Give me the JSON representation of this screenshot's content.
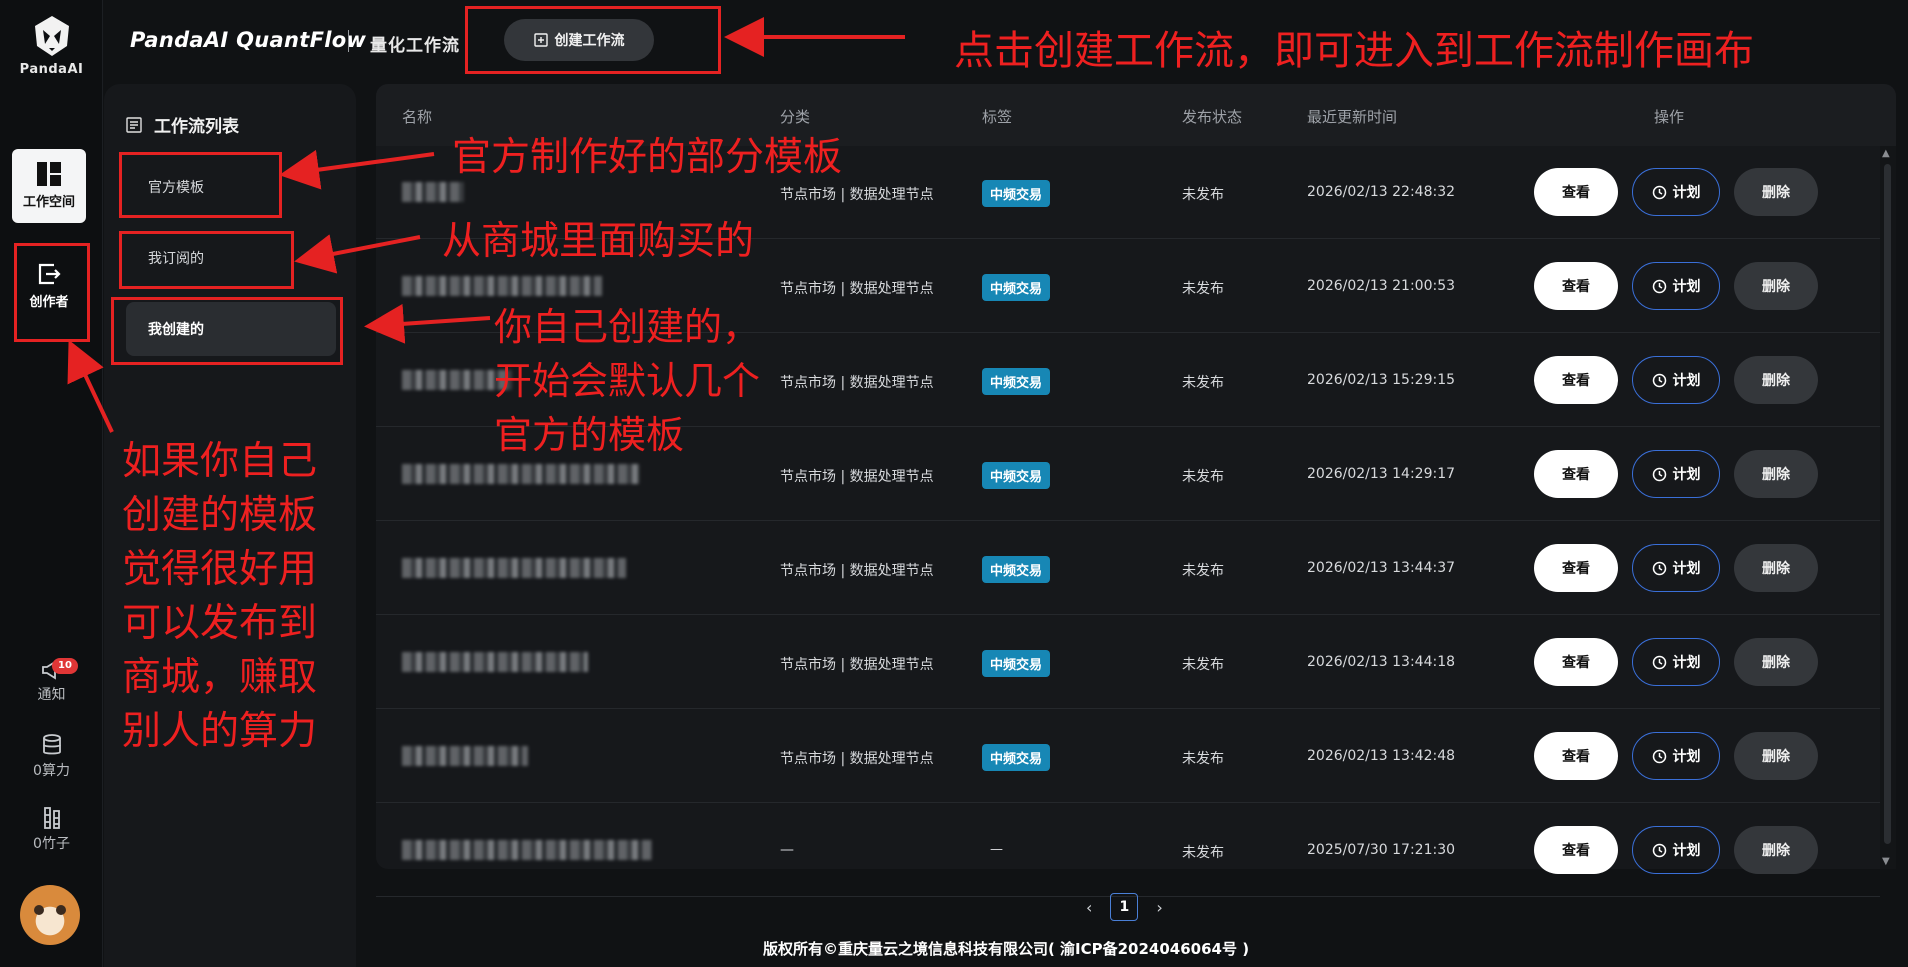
{
  "app": {
    "logo_text": "PandaAI",
    "brand": "PandaAI QuantFlow",
    "brand_sub": "量化工作流",
    "create_button": "创建工作流"
  },
  "rail": {
    "workspace_label": "工作空间",
    "creator_label": "创作者",
    "notify_label": "通知",
    "notify_badge": "10",
    "compute_label": "0算力",
    "bamboo_label": "0竹子"
  },
  "panel": {
    "title": "工作流列表",
    "items": [
      {
        "label": "官方模板"
      },
      {
        "label": "我订阅的"
      },
      {
        "label": "我创建的"
      }
    ]
  },
  "table": {
    "headers": [
      "名称",
      "分类",
      "标签",
      "发布状态",
      "最近更新时间",
      "操作"
    ],
    "rows": [
      {
        "category": "节点市场 | 数据处理节点",
        "tag": "中频交易",
        "status": "未发布",
        "updated": "2026/02/13 22:48:32"
      },
      {
        "category": "节点市场 | 数据处理节点",
        "tag": "中频交易",
        "status": "未发布",
        "updated": "2026/02/13 21:00:53"
      },
      {
        "category": "节点市场 | 数据处理节点",
        "tag": "中频交易",
        "status": "未发布",
        "updated": "2026/02/13 15:29:15"
      },
      {
        "category": "节点市场 | 数据处理节点",
        "tag": "中频交易",
        "status": "未发布",
        "updated": "2026/02/13 14:29:17"
      },
      {
        "category": "节点市场 | 数据处理节点",
        "tag": "中频交易",
        "status": "未发布",
        "updated": "2026/02/13 13:44:37"
      },
      {
        "category": "节点市场 | 数据处理节点",
        "tag": "中频交易",
        "status": "未发布",
        "updated": "2026/02/13 13:44:18"
      },
      {
        "category": "节点市场 | 数据处理节点",
        "tag": "中频交易",
        "status": "未发布",
        "updated": "2026/02/13 13:42:48"
      },
      {
        "category": "—",
        "tag": "—",
        "status": "未发布",
        "updated": "2025/07/30 17:21:30"
      }
    ],
    "actions": {
      "view": "查看",
      "plan": "计划",
      "delete": "删除"
    }
  },
  "pagination": {
    "current": "1"
  },
  "footer": "版权所有©重庆量云之境信息科技有限公司( 渝ICP备2024046064号 )",
  "annotations": {
    "create": "点击创建工作流，即可进入到工作流制作画布",
    "official": "官方制作好的部分模板",
    "subscribed": "从商城里面购买的",
    "mine_1": "你自己创建的，",
    "mine_2": "开始会默认几个",
    "mine_3": "官方的模板",
    "publish_1": "如果你自己",
    "publish_2": "创建的模板",
    "publish_3": "觉得很好用",
    "publish_4": "可以发布到",
    "publish_5": "商城，赚取",
    "publish_6": "别人的算力"
  },
  "colors": {
    "annotation": "#e52222",
    "tag": "#1787b5",
    "plan_border": "#3a6fd8"
  }
}
